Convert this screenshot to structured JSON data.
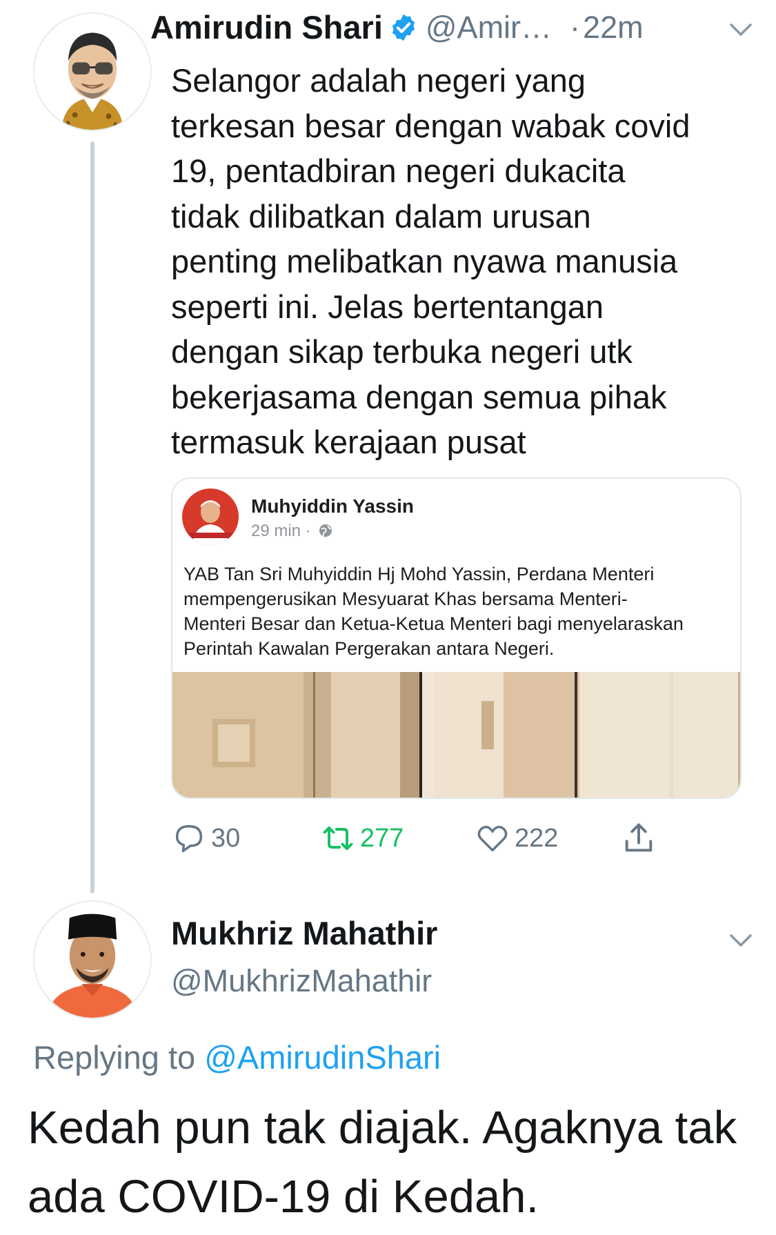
{
  "tweet": {
    "author_name": "Amirudin Shari",
    "author_handle": "@Amir…",
    "separator": "·",
    "time": "22m",
    "text": "Selangor adalah negeri yang\nterkesan besar dengan wabak covid\n19, pentadbiran negeri dukacita\ntidak dilibatkan dalam urusan\npenting melibatkan nyawa manusia\nseperti ini. Jelas bertentangan\ndengan sikap terbuka negeri utk\nbekerjasama dengan semua pihak\ntermasuk kerajaan pusat",
    "icons": {
      "avatar": "cartoon-avatar-icon",
      "verified": "verified-badge-icon",
      "menu": "chevron-down-icon"
    },
    "embedded_post": {
      "author": "Muhyiddin Yassin",
      "time": "29 min ·",
      "text": "YAB Tan Sri Muhyiddin Hj Mohd Yassin, Perdana Menteri\nmempengerusikan Mesyuarat Khas bersama Menteri-\nMenteri Besar dan Ketua-Ketua Menteri bagi menyelaraskan\nPerintah Kawalan Pergerakan antara Negeri."
    },
    "stats": {
      "replies": "30",
      "retweets": "277",
      "likes": "222"
    }
  },
  "reply": {
    "author_name": "Mukhriz Mahathir",
    "author_handle": "@MukhrizMahathir",
    "replying_label": "Replying to",
    "replying_to": "@AmirudinShari",
    "text": "Kedah pun tak diajak. Agaknya tak\nada COVID-19 di Kedah."
  },
  "colors": {
    "accent": "#1da1f2",
    "retweet_green": "#17bf63",
    "muted": "#657786",
    "text": "#14171a"
  }
}
